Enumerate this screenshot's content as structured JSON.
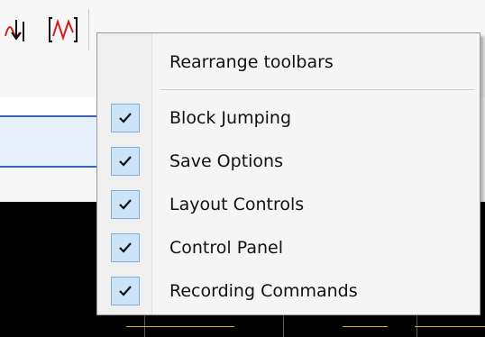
{
  "colors": {
    "accent": "#3a64b8",
    "check_bg": "#cce4f7",
    "check_border": "#7aaee0",
    "plot_bg": "#000000",
    "trace": "#e2b21c",
    "toolbar_icon": "#d81c1c"
  },
  "toolbar": {
    "icons": [
      "waveform-arrow-down-icon",
      "waveform-bracket-icon"
    ]
  },
  "context_menu": {
    "header_item": {
      "label": "Rearrange toolbars",
      "checked": false
    },
    "items": [
      {
        "label": "Block Jumping",
        "checked": true,
        "icon": "check-icon"
      },
      {
        "label": "Save Options",
        "checked": true,
        "icon": "check-icon"
      },
      {
        "label": "Layout Controls",
        "checked": true,
        "icon": "check-icon"
      },
      {
        "label": "Control Panel",
        "checked": true,
        "icon": "check-icon"
      },
      {
        "label": "Recording Commands",
        "checked": true,
        "icon": "check-icon"
      }
    ]
  }
}
